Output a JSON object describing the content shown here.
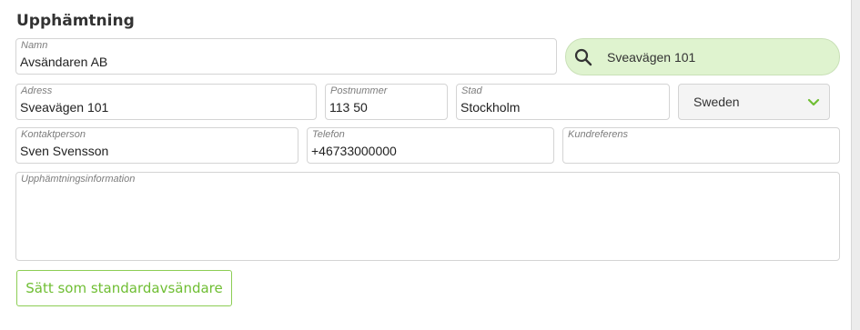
{
  "section": {
    "title": "Upphämtning"
  },
  "fields": {
    "name": {
      "label": "Namn",
      "value": "Avsändaren AB"
    },
    "address": {
      "label": "Adress",
      "value": "Sveavägen 101"
    },
    "postcode": {
      "label": "Postnummer",
      "value": "113 50"
    },
    "city": {
      "label": "Stad",
      "value": "Stockholm"
    },
    "contact": {
      "label": "Kontaktperson",
      "value": "Sven Svensson"
    },
    "phone": {
      "label": "Telefon",
      "value": "+46733000000"
    },
    "customer_ref": {
      "label": "Kundreferens",
      "value": ""
    },
    "pickup_info": {
      "label": "Upphämtningsinformation",
      "value": ""
    }
  },
  "address_search": {
    "value": "Sveavägen 101",
    "icon": "search-icon"
  },
  "country_select": {
    "selected": "Sweden",
    "icon": "chevron-down-icon"
  },
  "actions": {
    "set_default_label": "Sätt som standardavsändare"
  },
  "colors": {
    "accent_green": "#6fbe33",
    "search_background": "#dff3cf",
    "border": "#d4d4d4"
  }
}
